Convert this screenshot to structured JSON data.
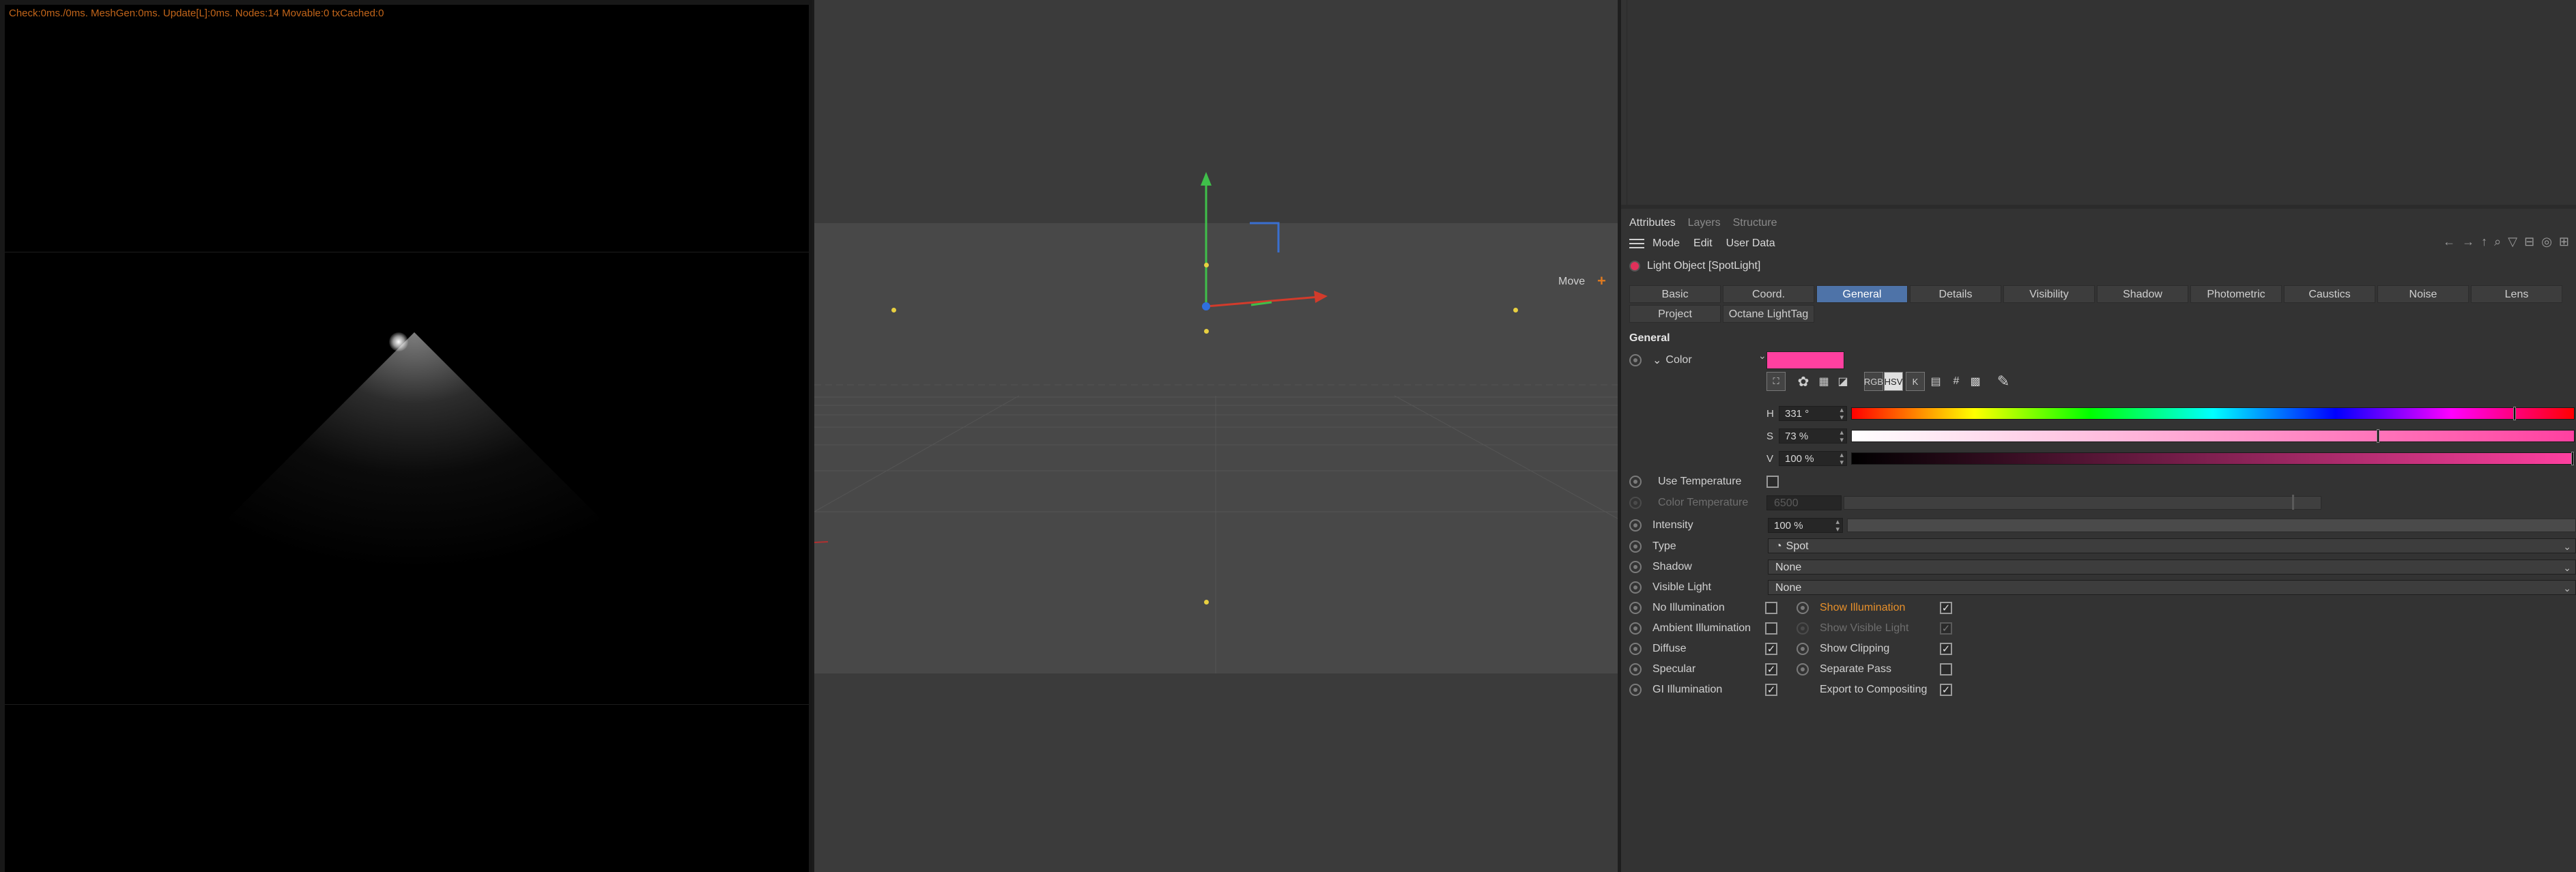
{
  "render_view": {
    "stats": "Check:0ms./0ms. MeshGen:0ms. Update[L]:0ms. Nodes:14 Movable:0 txCached:0"
  },
  "viewport": {
    "tool_label": "Move",
    "tool_icon": "plus-icon"
  },
  "attributes": {
    "tabs": [
      "Attributes",
      "Layers",
      "Structure"
    ],
    "active_tab": "Attributes",
    "menu": [
      "Mode",
      "Edit",
      "User Data"
    ],
    "nav_icons": [
      "back-arrow-icon",
      "forward-arrow-icon",
      "up-arrow-icon",
      "search-icon",
      "filter-icon",
      "lock-icon",
      "target-icon",
      "new-panel-icon"
    ],
    "object_title": "Light Object [SpotLight]",
    "property_tabs_row1": [
      "Basic",
      "Coord.",
      "General",
      "Details",
      "Visibility",
      "Shadow",
      "Photometric",
      "Caustics",
      "Noise",
      "Lens"
    ],
    "property_tabs_row2": [
      "Project",
      "Octane LightTag"
    ],
    "active_property_tab": "General",
    "section_title": "General",
    "color": {
      "label": "Color",
      "value_hex": "#ff40a0",
      "mode_buttons": [
        "RGB",
        "HSV",
        "K"
      ],
      "active_mode": "HSV",
      "h": "331 °",
      "s": "73 %",
      "v": "100 %",
      "h_fraction": 0.919,
      "s_fraction": 0.73,
      "v_fraction": 1.0
    },
    "use_temperature": {
      "label": "Use Temperature",
      "checked": false
    },
    "color_temperature": {
      "label": "Color Temperature",
      "value": "6500",
      "enabled": false
    },
    "intensity": {
      "label": "Intensity",
      "value": "100 %"
    },
    "type": {
      "label": "Type",
      "value": "Spot"
    },
    "shadow": {
      "label": "Shadow",
      "value": "None"
    },
    "visible_light": {
      "label": "Visible Light",
      "value": "None"
    },
    "checks_left": [
      {
        "label": "No Illumination",
        "checked": false
      },
      {
        "label": "Ambient Illumination",
        "checked": false
      },
      {
        "label": "Diffuse",
        "checked": true
      },
      {
        "label": "Specular",
        "checked": true
      },
      {
        "label": "GI Illumination",
        "checked": true
      }
    ],
    "checks_right": [
      {
        "label": "Show Illumination",
        "checked": true,
        "highlight": true
      },
      {
        "label": "Show Visible Light",
        "checked": true,
        "disabled": true
      },
      {
        "label": "Show Clipping",
        "checked": true
      },
      {
        "label": "Separate Pass",
        "checked": false
      },
      {
        "label": "Export to Compositing",
        "checked": true
      }
    ],
    "check_mark": "✓"
  }
}
